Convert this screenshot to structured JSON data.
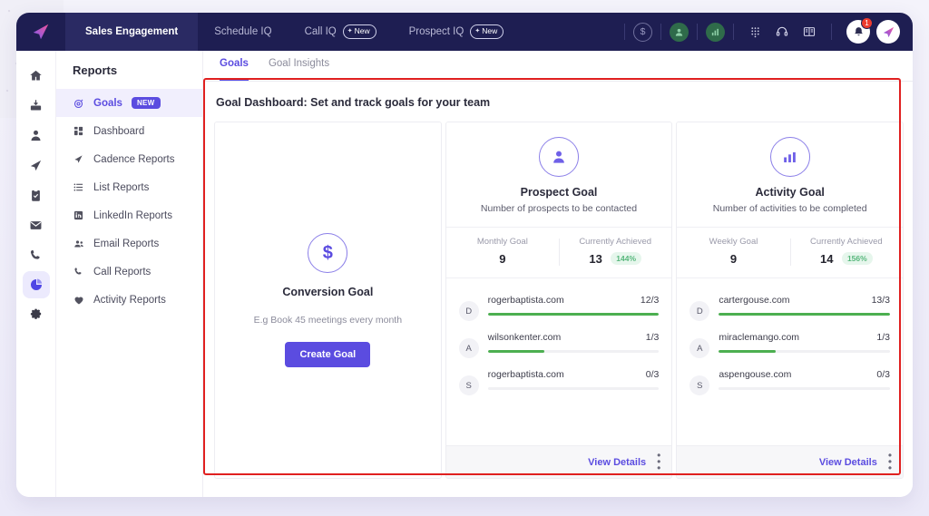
{
  "topnav": {
    "logo_icon": "paper-plane-icon",
    "tabs": [
      {
        "label": "Sales Engagement",
        "active": true,
        "badge": null
      },
      {
        "label": "Schedule IQ",
        "active": false,
        "badge": null
      },
      {
        "label": "Call IQ",
        "active": false,
        "badge": "New"
      },
      {
        "label": "Prospect IQ",
        "active": false,
        "badge": "New"
      }
    ],
    "right_icons": [
      {
        "name": "dollar-icon",
        "glyph": "$"
      },
      {
        "name": "person-icon",
        "glyph": "●"
      },
      {
        "name": "chart-icon",
        "glyph": "▥"
      },
      {
        "name": "dialpad-icon",
        "glyph": "∷"
      },
      {
        "name": "headset-icon",
        "glyph": "Ω"
      },
      {
        "name": "book-icon",
        "glyph": "▤"
      }
    ],
    "notification_count": "1",
    "bell_icon": "bell-icon",
    "avatar_icon": "paper-plane-icon"
  },
  "rail": {
    "items": [
      {
        "name": "home-icon",
        "active": false
      },
      {
        "name": "inbox-icon",
        "active": false
      },
      {
        "name": "contacts-icon",
        "active": false
      },
      {
        "name": "send-icon",
        "active": false
      },
      {
        "name": "tasks-icon",
        "active": false
      },
      {
        "name": "mail-icon",
        "active": false
      },
      {
        "name": "call-icon",
        "active": false
      },
      {
        "name": "reports-icon",
        "active": true
      },
      {
        "name": "settings-icon",
        "active": false
      }
    ]
  },
  "sidebar": {
    "title": "Reports",
    "items": [
      {
        "label": "Goals",
        "icon": "target-icon",
        "active": true,
        "badge": "NEW"
      },
      {
        "label": "Dashboard",
        "icon": "dashboard-icon",
        "active": false,
        "badge": null
      },
      {
        "label": "Cadence Reports",
        "icon": "send-icon",
        "active": false,
        "badge": null
      },
      {
        "label": "List Reports",
        "icon": "list-icon",
        "active": false,
        "badge": null
      },
      {
        "label": "LinkedIn Reports",
        "icon": "linkedin-icon",
        "active": false,
        "badge": null
      },
      {
        "label": "Email Reports",
        "icon": "people-icon",
        "active": false,
        "badge": null
      },
      {
        "label": "Call Reports",
        "icon": "phone-icon",
        "active": false,
        "badge": null
      },
      {
        "label": "Activity Reports",
        "icon": "heart-icon",
        "active": false,
        "badge": null
      }
    ]
  },
  "main": {
    "tabs": [
      {
        "label": "Goals",
        "active": true
      },
      {
        "label": "Goal Insights",
        "active": false
      }
    ],
    "dashboard_title": "Goal Dashboard: Set and track goals for your team",
    "conversion_card": {
      "icon": "dollar-circle-icon",
      "icon_glyph": "$",
      "title": "Conversion Goal",
      "subtitle": "E.g Book 45 meetings every month",
      "button_label": "Create Goal"
    },
    "goal_cards": [
      {
        "icon": "person-circle-icon",
        "icon_glyph": "●",
        "title": "Prospect Goal",
        "subtitle": "Number of prospects to be contacted",
        "stats": [
          {
            "label": "Monthly Goal",
            "value": "9",
            "percent": null
          },
          {
            "label": "Currently Achieved",
            "value": "13",
            "percent": "144%"
          }
        ],
        "rows": [
          {
            "avatar": "D",
            "name": "rogerbaptista.com",
            "count": "12/3",
            "progress": 100
          },
          {
            "avatar": "A",
            "name": "wilsonkenter.com",
            "count": "1/3",
            "progress": 33
          },
          {
            "avatar": "S",
            "name": "rogerbaptista.com",
            "count": "0/3",
            "progress": 0
          }
        ],
        "footer_label": "View Details",
        "menu_icon": "kebab-menu-icon"
      },
      {
        "icon": "bar-chart-circle-icon",
        "icon_glyph": "▥",
        "title": "Activity Goal",
        "subtitle": "Number of activities to be completed",
        "stats": [
          {
            "label": "Weekly Goal",
            "value": "9",
            "percent": null
          },
          {
            "label": "Currently Achieved",
            "value": "14",
            "percent": "156%"
          }
        ],
        "rows": [
          {
            "avatar": "D",
            "name": "cartergouse.com",
            "count": "13/3",
            "progress": 100
          },
          {
            "avatar": "A",
            "name": "miraclemango.com",
            "count": "1/3",
            "progress": 33
          },
          {
            "avatar": "S",
            "name": "aspengouse.com",
            "count": "0/3",
            "progress": 0
          }
        ],
        "footer_label": "View Details",
        "menu_icon": "kebab-menu-icon"
      }
    ]
  },
  "colors": {
    "accent": "#5b4ce0",
    "topbar": "#1e1e52",
    "progress": "#4caf50",
    "highlight": "#e02020",
    "badge_success_bg": "#e6f6ec",
    "badge_success_text": "#57b77c"
  }
}
